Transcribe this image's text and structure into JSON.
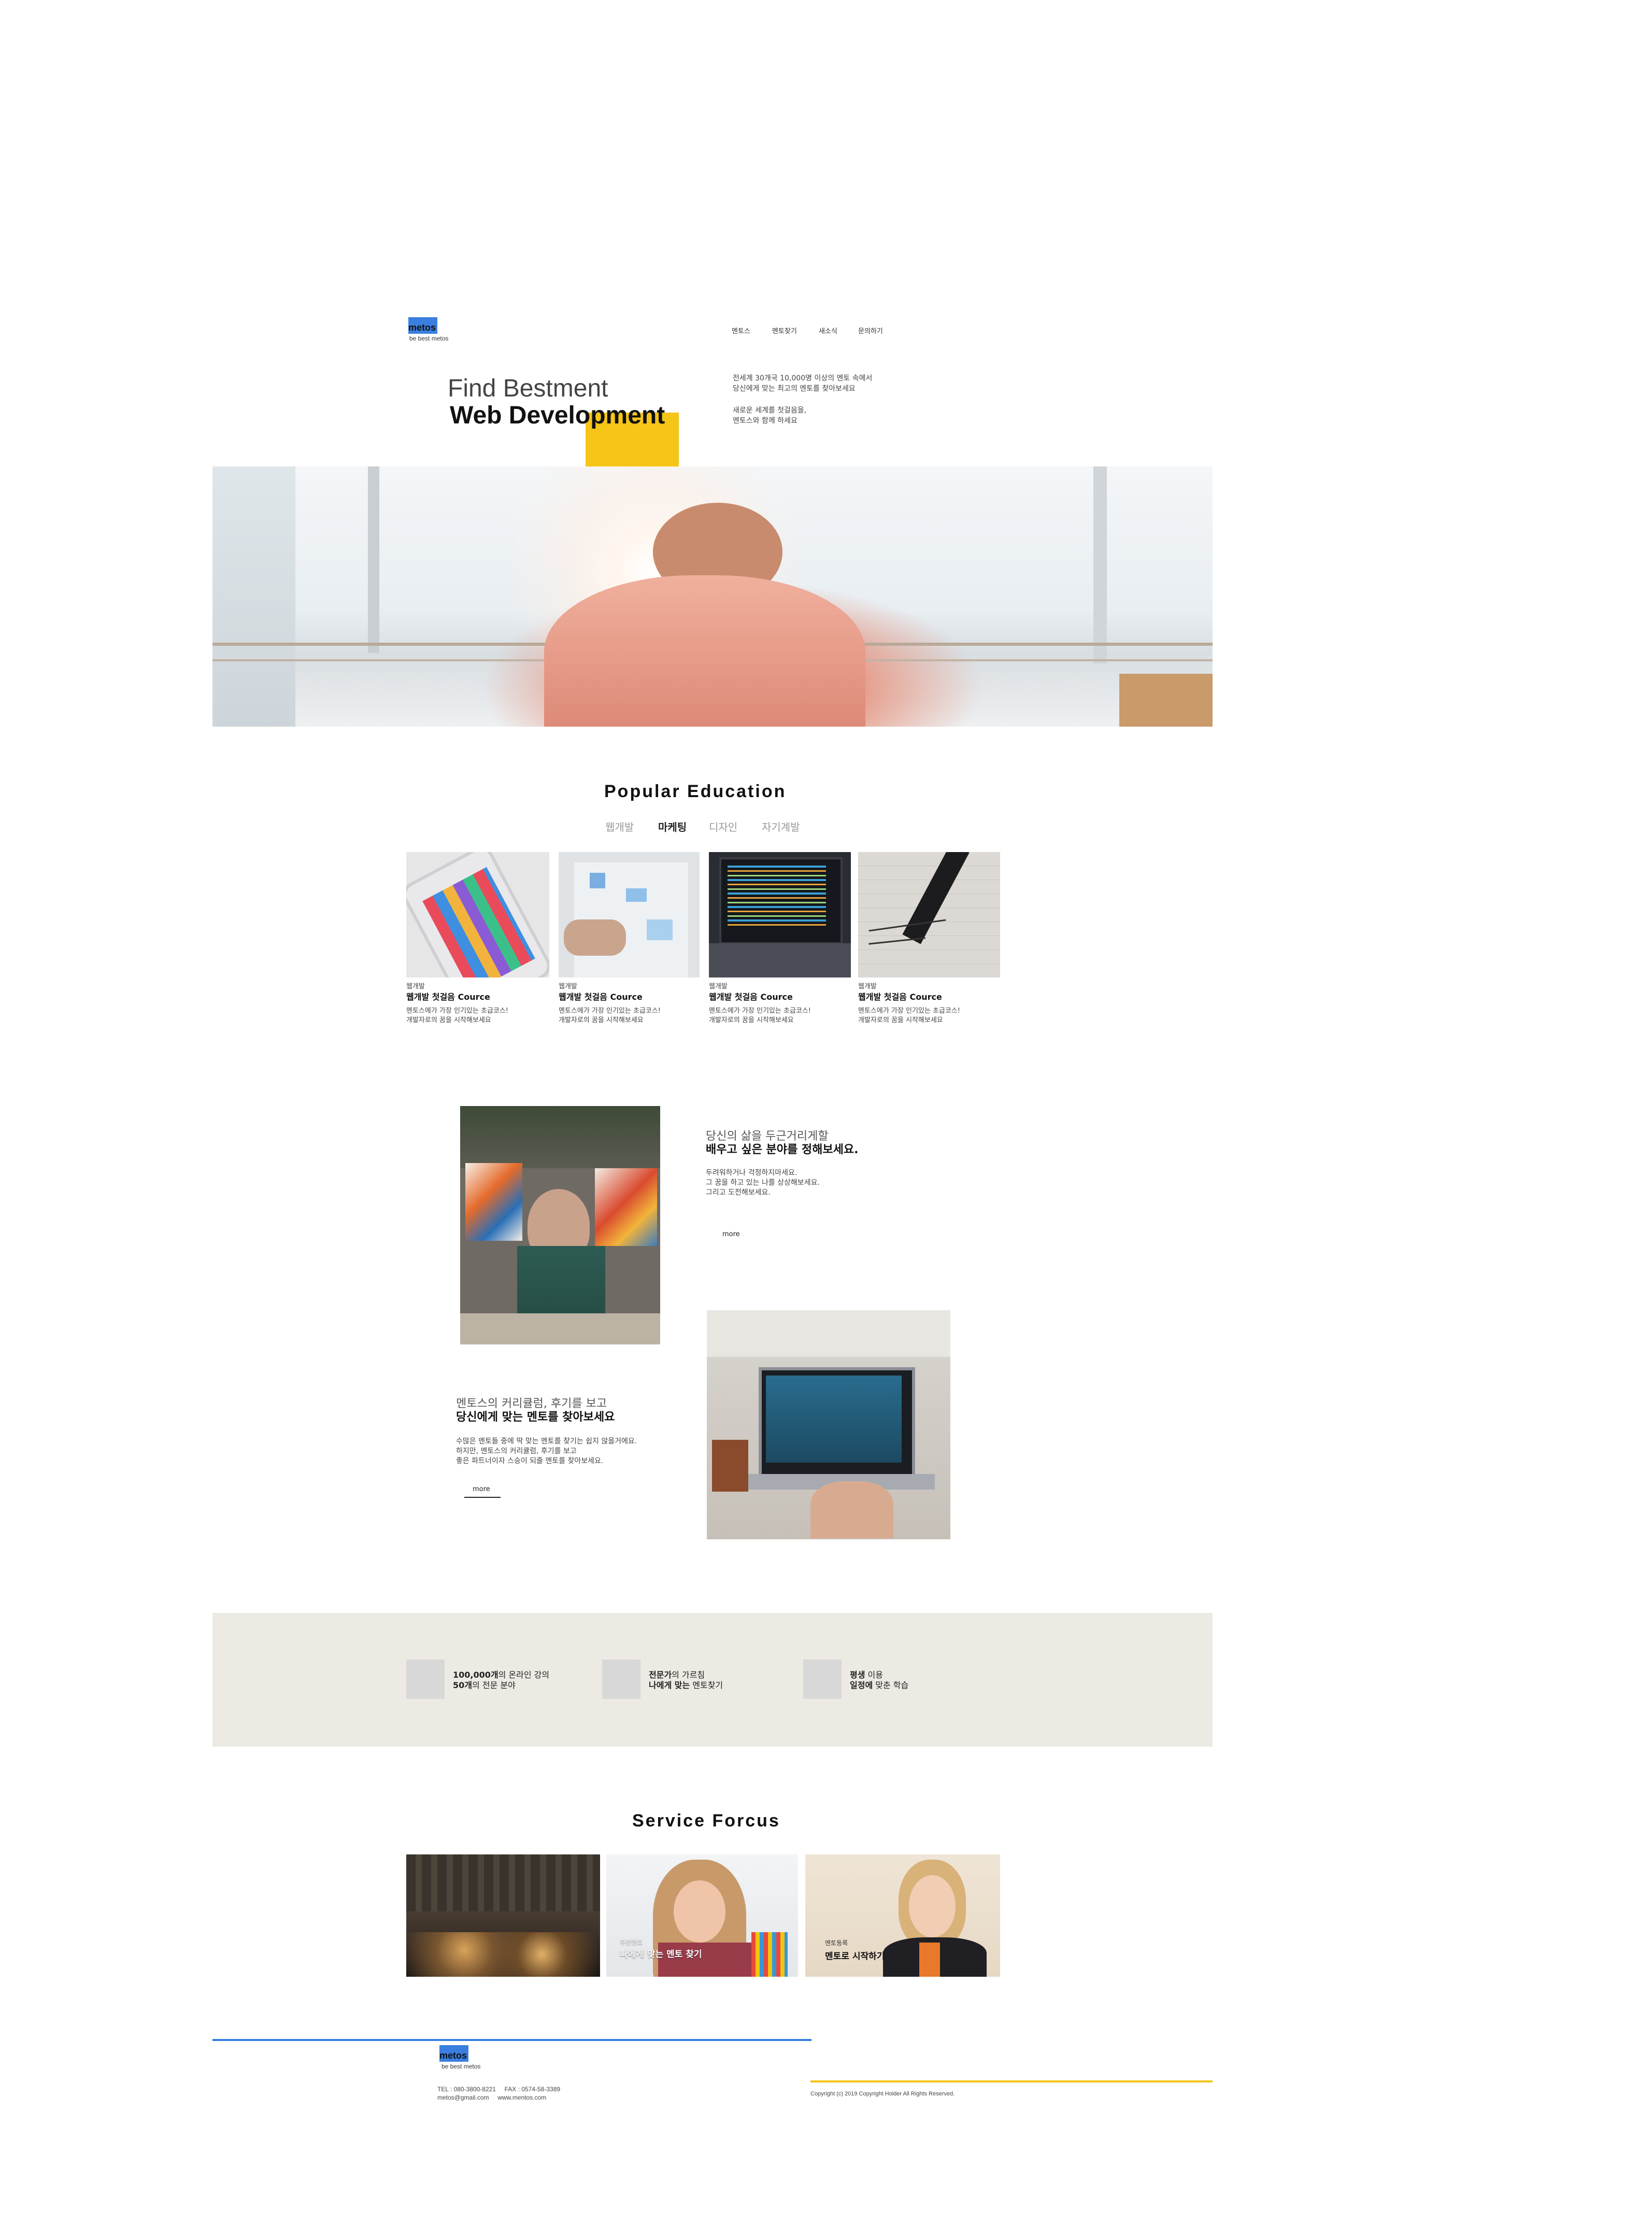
{
  "brand": {
    "logo": "metos",
    "tagline": "be best metos"
  },
  "nav": {
    "items": [
      "멘토스",
      "멘토찾기",
      "새소식",
      "문의하기"
    ]
  },
  "hero": {
    "title_light": "Find Bestment",
    "title_bold": "Web Development",
    "intro_line1": "전세계 30개국  10,000명 이상의 멘토 속에서",
    "intro_line2": "당신에게 맞는 최고의 멘토를 찾아보세요",
    "intro_line3": "새로운 세계를 첫걸음을,",
    "intro_line4": "멘토스와 함께 하세요"
  },
  "popular": {
    "title": "Popular Education",
    "tabs": [
      "웹개발",
      "마케팅",
      "디자인",
      "자기계발"
    ],
    "active_tab": "마케팅",
    "cards": [
      {
        "image": "smartphone-photo",
        "category": "웹개발",
        "title": "웹개발 첫걸음 Cource",
        "desc1": "멘토스에가 가장 인기있는 초급코스!",
        "desc2": "개발자로의 꿈을 시작해보세요"
      },
      {
        "image": "whiteboard-photo",
        "category": "웹개발",
        "title": "웹개발 첫걸음 Cource",
        "desc1": "멘토스에가 가장 인기있는 초급코스!",
        "desc2": "개발자로의 꿈을 시작해보세요"
      },
      {
        "image": "laptop-code-photo",
        "category": "웹개발",
        "title": "웹개발 첫걸음 Cource",
        "desc1": "멘토스에가 가장 인기있는 초급코스!",
        "desc2": "개발자로의 꿈을 시작해보세요"
      },
      {
        "image": "fountain-pen-photo",
        "category": "웹개발",
        "title": "웹개발 첫걸음 Cource",
        "desc1": "멘토스에가 가장 인기있는 초급코스!",
        "desc2": "개발자로의 꿈을 시작해보세요"
      }
    ]
  },
  "feature1": {
    "subtitle": "당신의 삶을 두근거리게할",
    "heading": "배우고 싶은 분야를 정해보세요.",
    "body1": "두려워하거나 걱정하지마세요.",
    "body2": "그 꿈을 하고 있는 나를 상상해보세요.",
    "body3": "그리고 도전해보세요.",
    "more": "more"
  },
  "feature2": {
    "subtitle": "멘토스의 커리큘럼, 후기를 보고",
    "heading": "당신에게 맞는 멘토를 찾아보세요",
    "body1": "수많은 멘토들 중에 딱 맞는 멘토를 찾기는 쉽지 않을거에요.",
    "body2": "하지만, 멘토스의 커리큘럼, 후기를 보고",
    "body3": "좋은 파트너이자 스승이 되줄 멘토를 찾아보세요.",
    "more": "more"
  },
  "stats": [
    {
      "bold1": "100,000개",
      "rest1": "의 온라인 강의",
      "bold2": "50개",
      "rest2": "의 전문 분야"
    },
    {
      "bold1": "전문가",
      "rest1": "의 가르침",
      "bold2": "나에게 맞는",
      "rest2": " 멘토찾기"
    },
    {
      "bold1": "평생",
      "rest1": " 이용",
      "bold2": "일정에",
      "rest2": " 맞춘 학습"
    }
  ],
  "service": {
    "title": "Service Forcus",
    "cards": [
      {
        "image": "concert-photo",
        "small": "",
        "label": ""
      },
      {
        "image": "student-photo",
        "small": "추천멘토",
        "label": "나에게 맞는 멘토 찾기"
      },
      {
        "image": "mentor-woman-photo",
        "small": "멘토등록",
        "label": "멘토로 시작하기"
      }
    ]
  },
  "footer": {
    "logo": "metos",
    "tagline": "be best metos",
    "contact1": "TEL : 080-3800-8221     FAX : 0574-58-3389",
    "contact2": "metos@gmail.com     www.mentos.com",
    "copyright": "Copyright (c) 2019 Copyright Holder All Rights Reserved."
  },
  "colors": {
    "accent_blue": "#3a7fe0",
    "accent_yellow": "#f5c518",
    "stats_bg": "#eceae3"
  }
}
